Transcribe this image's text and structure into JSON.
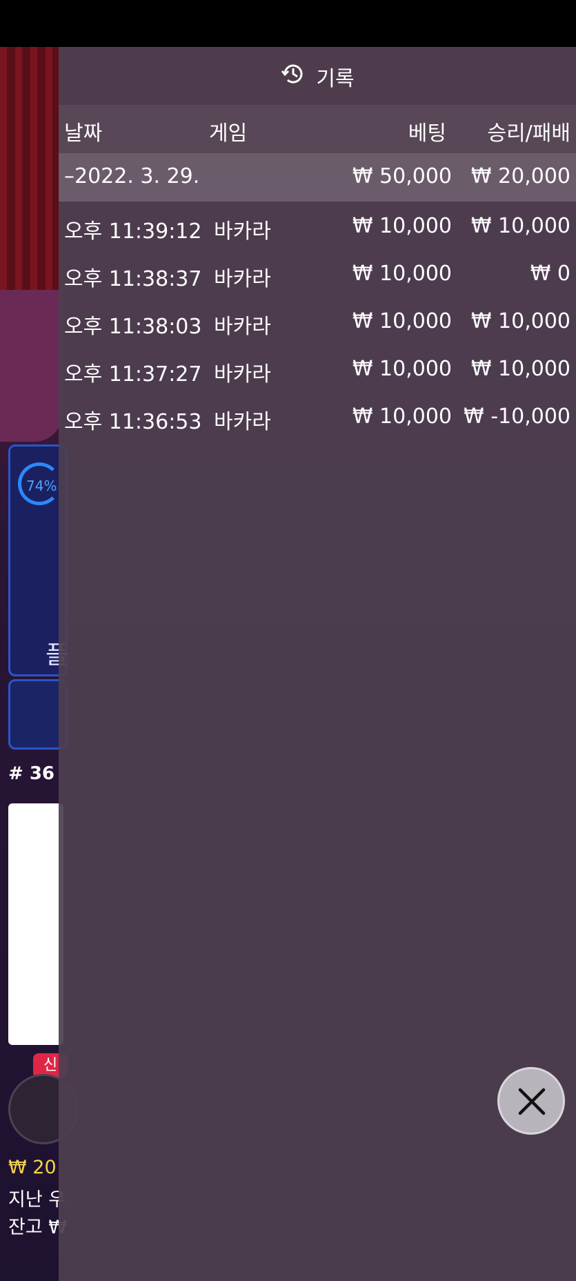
{
  "history": {
    "title": "기록",
    "columns": {
      "date": "날짜",
      "game": "게임",
      "bet": "베팅",
      "winloss": "승리/패배"
    },
    "date_group": {
      "label": "–2022. 3. 29.",
      "bet_total": "₩ 50,000",
      "win_total": "₩ 20,000"
    },
    "rows": [
      {
        "time": "오후 11:39:12",
        "game": "바카라",
        "bet": "₩ 10,000",
        "winloss": "₩ 10,000"
      },
      {
        "time": "오후 11:38:37",
        "game": "바카라",
        "bet": "₩ 10,000",
        "winloss": "₩ 0"
      },
      {
        "time": "오후 11:38:03",
        "game": "바카라",
        "bet": "₩ 10,000",
        "winloss": "₩ 10,000"
      },
      {
        "time": "오후 11:37:27",
        "game": "바카라",
        "bet": "₩ 10,000",
        "winloss": "₩ 10,000"
      },
      {
        "time": "오후 11:36:53",
        "game": "바카라",
        "bet": "₩ 10,000",
        "winloss": "₩ -10,000"
      }
    ]
  },
  "background": {
    "progress_label": "74%",
    "progress_value": 0.74,
    "player_label": "플",
    "shoe_number": "# 36",
    "new_badge": "신",
    "balance_line": "₩ 20",
    "last_win_line": "지난 우",
    "wallet_line": "잔고 ₩"
  },
  "colors": {
    "accent_blue": "#2a89ff",
    "overlay": "#4e4050",
    "badge_red": "#e02646"
  }
}
